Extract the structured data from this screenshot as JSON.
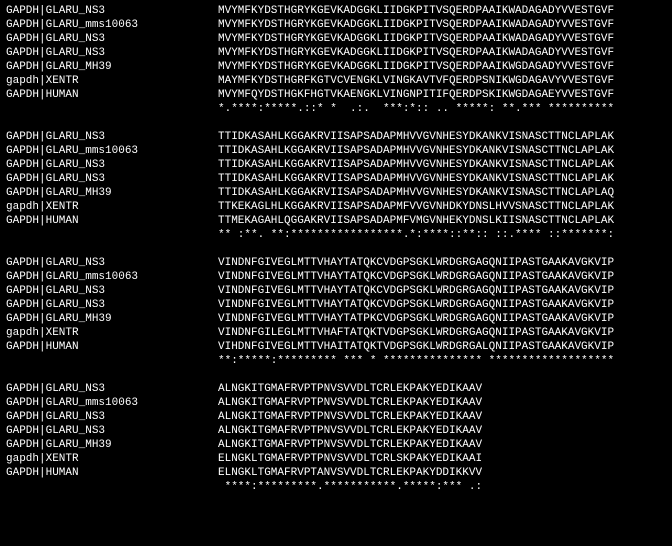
{
  "labels": [
    "GAPDH|GLARU_NS3",
    "GAPDH|GLARU_mms10063",
    "GAPDH|GLARU_NS3",
    "GAPDH|GLARU_NS3",
    "GAPDH|GLARU_MH39",
    "gapdh|XENTR",
    "GAPDH|HUMAN"
  ],
  "blocks": [
    {
      "seqs": [
        "MVYMFKYDSTHGRYKGEVKADGGKLIIDGKPITVSQERDPAAIKWADAGADYVVESTGVF",
        "MVYMFKYDSTHGRYKGEVKADGGKLIIDGKPITVSQERDPAAIKWADAGADYVVESTGVF",
        "MVYMFKYDSTHGRYKGEVKADGGKLIIDGKPITVSQERDPAAIKWADAGADYVVESTGVF",
        "MVYMFKYDSTHGRYKGEVKADGGKLIIDGKPITVSQERDPAAIKWADAGADYVVESTGVF",
        "MVYMFKYDSTHGRYKGEVKADGGKLIIDGKPITVSQERDPAAIKWGDAGADYVVESTGVF",
        "MAYMFKYDSTHGRFKGTVCVENGKLVINGKAVTVFQERDPSNIKWGDAGAVYVVESTGVF",
        "MVYMFQYDSTHGKFHGTVKAENGKLVINGNPITIFQERDPSKIKWGDAGAEYVVESTGVF"
      ],
      "consensus": "*.****:*****.::* *  .:.  ***:*:: .. *****: **.*** **********"
    },
    {
      "seqs": [
        "TTIDKASAHLKGGAKRVIISAPSADAPMHVVGVNHESYDKANKVISNASCTTNCLAPLAK",
        "TTIDKASAHLKGGAKRVIISAPSADAPMHVVGVNHESYDKANKVISNASCTTNCLAPLAK",
        "TTIDKASAHLKGGAKRVIISAPSADAPMHVVGVNHESYDKANKVISNASCTTNCLAPLAK",
        "TTIDKASAHLKGGAKRVIISAPSADAPMHVVGVNHESYDKANKVISNASCTTNCLAPLAK",
        "TTIDKASAHLKGGAKRVIISAPSADAPMHVVGVNHESYDKANKVISNASCTTNCLAPLAQ",
        "TTKEKAGLHLKGGAKRVIISAPSADAPMFVVGVNHDKYDNSLHVVSNASCTTNCLAPLAK",
        "TTMEKAGAHLQGGAKRVIISAPSADAPMFVMGVNHEKYDNSLKIISNASCTTNCLAPLAK"
      ],
      "consensus": "** :**. **:*****************.*:****::**:: ::.**** ::*******:"
    },
    {
      "seqs": [
        "VINDNFGIVEGLMTTVHAYTATQKCVDGPSGKLWRDGRGAGQNIIPASTGAAKAVGKVIP",
        "VINDNFGIVEGLMTTVHAYTATQKCVDGPSGKLWRDGRGAGQNIIPASTGAAKAVGKVIP",
        "VINDNFGIVEGLMTTVHAYTATQKCVDGPSGKLWRDGRGAGQNIIPASTGAAKAVGKVIP",
        "VINDNFGIVEGLMTTVHAYTATQKCVDGPSGKLWRDGRGAGQNIIPASTGAAKAVGKVIP",
        "VINDNFGIVEGLMTTVHAYTATPKCVDGPSGKLWRDGRGAGQNIIPASTGAAKAVGKVIP",
        "VINDNFGILEGLMTTVHAFTATQKTVDGPSGKLWRDGRGAGQNIIPASTGAAKAVGKVIP",
        "VIHDNFGIVEGLMTTVHAITATQKTVDGPSGKLWRDGRGALQNIIPASTGAAKAVGKVIP"
      ],
      "consensus": "**:*****:********* *** * *************** *******************"
    },
    {
      "seqs": [
        "ALNGKITGMAFRVPTPNVSVVDLTCRLEKPAKYEDIKAAV",
        "ALNGKITGMAFRVPTPNVSVVDLTCRLEKPAKYEDIKAAV",
        "ALNGKITGMAFRVPTPNVSVVDLTCRLEKPAKYEDIKAAV",
        "ALNGKITGMAFRVPTPNVSVVDLTCRLEKPAKYEDIKAAV",
        "ALNGKITGMAFRVPTPNVSVVDLTCRLEKPAKYEDIKAAV",
        "ELNGKLTGMAFRVPTPNVSVVDLTCRLSKPAKYEDIKAAI",
        "ELNGKLTGMAFRVPTANVSVVDLTCRLEKPAKYDDIKKVV"
      ],
      "consensus": " ****:*********.***********.*****:*** .:"
    }
  ]
}
